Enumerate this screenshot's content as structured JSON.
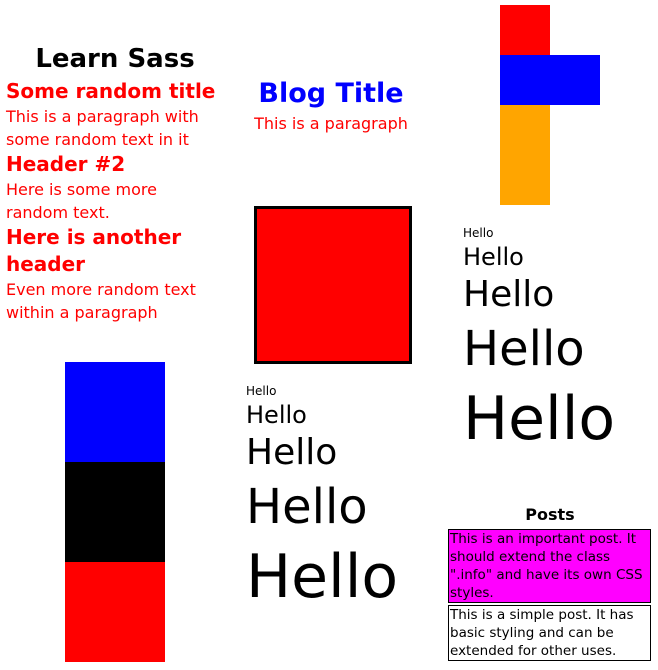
{
  "learn": {
    "heading": "Learn Sass",
    "sections": [
      {
        "title": "Some random title",
        "text": "This is a paragraph with some random text in it"
      },
      {
        "title": "Header #2",
        "text": "Here is some more random text."
      },
      {
        "title": "Here is another header",
        "text": "Even more random text within a paragraph"
      }
    ]
  },
  "blog": {
    "title": "Blog Title",
    "text": "This is a paragraph"
  },
  "hello_stack_right": [
    "Hello",
    "Hello",
    "Hello",
    "Hello",
    "Hello"
  ],
  "hello_stack_middle": [
    "Hello",
    "Hello",
    "Hello",
    "Hello",
    "Hello"
  ],
  "posts": {
    "heading": "Posts",
    "important": "This is an important post. It should extend the class \".info\" and have its own CSS styles.",
    "simple": "This is a simple post. It has basic styling and can be extended for other uses."
  },
  "colors": {
    "red": "#ff0000",
    "blue": "#0000ff",
    "orange": "#ffa500",
    "black": "#000000",
    "magenta": "#ff00ff"
  }
}
